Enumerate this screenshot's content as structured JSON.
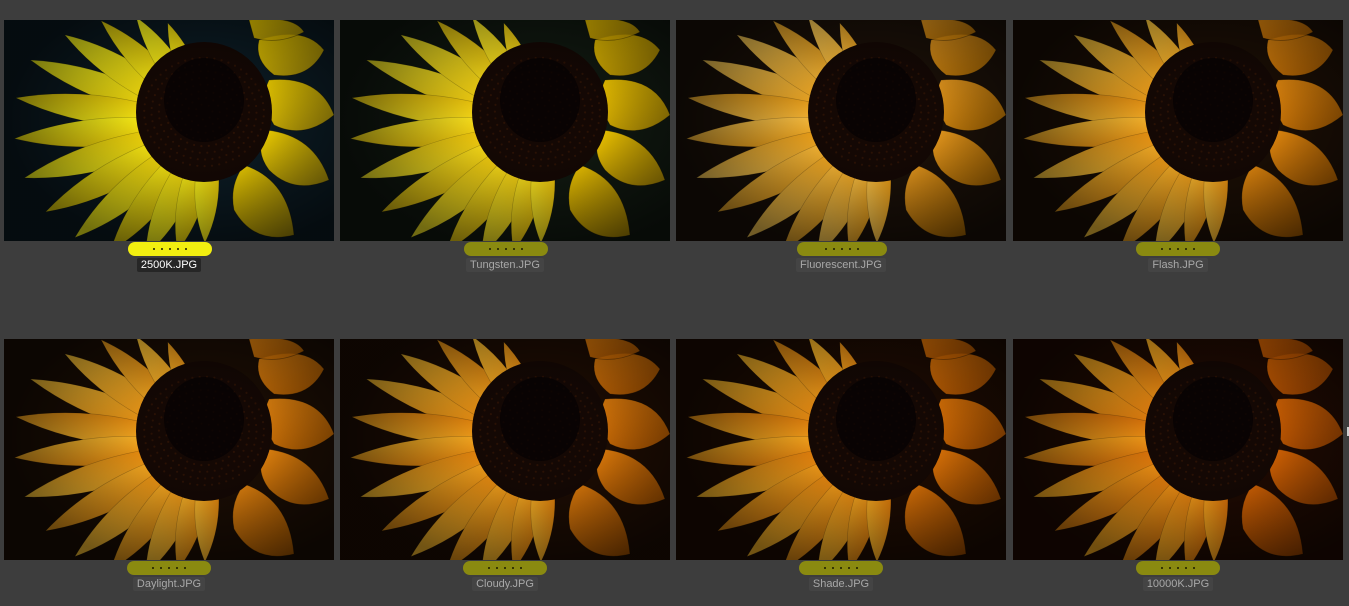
{
  "browser": {
    "items": [
      {
        "filename": "2500K.JPG",
        "selected": true,
        "label_color": "#f2ef10",
        "petal_light": "#ffff20",
        "petal_dark": "#e0b800",
        "petal_back": "#f0d000",
        "bg": "#0b1a22"
      },
      {
        "filename": "Tungsten.JPG",
        "selected": false,
        "label_color": "#8a8a10",
        "petal_light": "#fff22a",
        "petal_dark": "#e7b400",
        "petal_back": "#f2c800",
        "bg": "#101810"
      },
      {
        "filename": "Fluorescent.JPG",
        "selected": false,
        "label_color": "#8a8a10",
        "petal_light": "#ffd05a",
        "petal_dark": "#e08a00",
        "petal_back": "#e89a20",
        "bg": "#1a1008"
      },
      {
        "filename": "Flash.JPG",
        "selected": false,
        "label_color": "#8a8a10",
        "petal_light": "#ffcc40",
        "petal_dark": "#dd7a00",
        "petal_back": "#e48a10",
        "bg": "#1a0e05"
      },
      {
        "filename": "Daylight.JPG",
        "selected": false,
        "label_color": "#8a8a10",
        "petal_light": "#ffc838",
        "petal_dark": "#dc7400",
        "petal_back": "#e28410",
        "bg": "#1a0d04"
      },
      {
        "filename": "Cloudy.JPG",
        "selected": false,
        "label_color": "#8a8a10",
        "petal_light": "#ffc230",
        "petal_dark": "#d86c00",
        "petal_back": "#de7c0c",
        "bg": "#1c0c03"
      },
      {
        "filename": "Shade.JPG",
        "selected": false,
        "label_color": "#8a8a10",
        "petal_light": "#ffbe2c",
        "petal_dark": "#d46600",
        "petal_back": "#dc7408",
        "bg": "#1c0b02"
      },
      {
        "filename": "10000K.JPG",
        "selected": false,
        "label_color": "#8a8a10",
        "petal_light": "#ffb424",
        "petal_dark": "#cc5a00",
        "petal_back": "#d46404",
        "bg": "#1e0a02"
      }
    ],
    "rating_dots": 5,
    "center_color": "#140804",
    "thumb_subject": "sunflower-photo"
  }
}
